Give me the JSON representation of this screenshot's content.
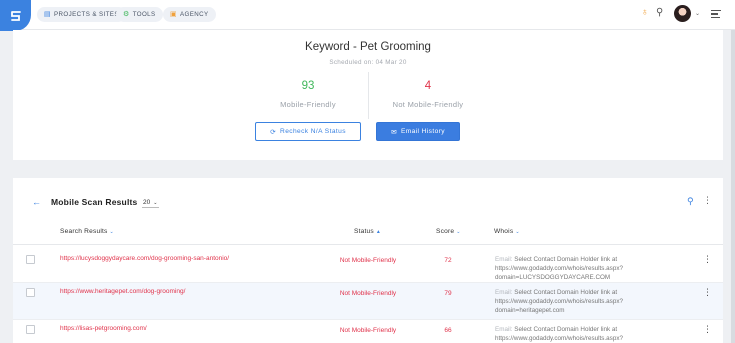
{
  "nav": {
    "items": [
      {
        "label": "PROJECTS & SITES",
        "icon": "projects-icon"
      },
      {
        "label": "TOOLS",
        "icon": "tools-icon"
      },
      {
        "label": "AGENCY",
        "icon": "agency-icon"
      }
    ]
  },
  "summary": {
    "title": "Keyword - Pet Grooming",
    "scheduled": "Scheduled on: 04 Mar 20",
    "mobile_friendly": {
      "count": "93",
      "label": "Mobile-Friendly",
      "color": "#3fb75a"
    },
    "not_mobile_friendly": {
      "count": "4",
      "label": "Not Mobile-Friendly",
      "color": "#e0334b"
    },
    "recheck_label": "Recheck N/A Status",
    "email_label": "Email History"
  },
  "results": {
    "title": "Mobile Scan Results",
    "page_size": "20",
    "columns": {
      "search_results": "Search Results",
      "status": "Status",
      "score": "Score",
      "whois": "Whois"
    },
    "rows": [
      {
        "url": "https://lucysdoggydaycare.com/dog-grooming-san-antonio/",
        "status": "Not Mobile-Friendly",
        "score": "72",
        "whois_prefix": "Email:",
        "whois_text": "Select Contact Domain Holder link at https://www.godaddy.com/whois/results.aspx?domain=LUCYSDOGGYDAYCARE.COM"
      },
      {
        "url": "https://www.heritagepet.com/dog-grooming/",
        "status": "Not Mobile-Friendly",
        "score": "79",
        "whois_prefix": "Email:",
        "whois_text": "Select Contact Domain Holder link at https://www.godaddy.com/whois/results.aspx?domain=heritagepet.com"
      },
      {
        "url": "https://lisas-petgrooming.com/",
        "status": "Not Mobile-Friendly",
        "score": "66",
        "whois_prefix": "Email:",
        "whois_text": "Select Contact Domain Holder link at https://www.godaddy.com/whois/results.aspx?"
      }
    ]
  },
  "colors": {
    "accent": "#3b82e0",
    "danger": "#e0334b",
    "success": "#3fb75a"
  }
}
